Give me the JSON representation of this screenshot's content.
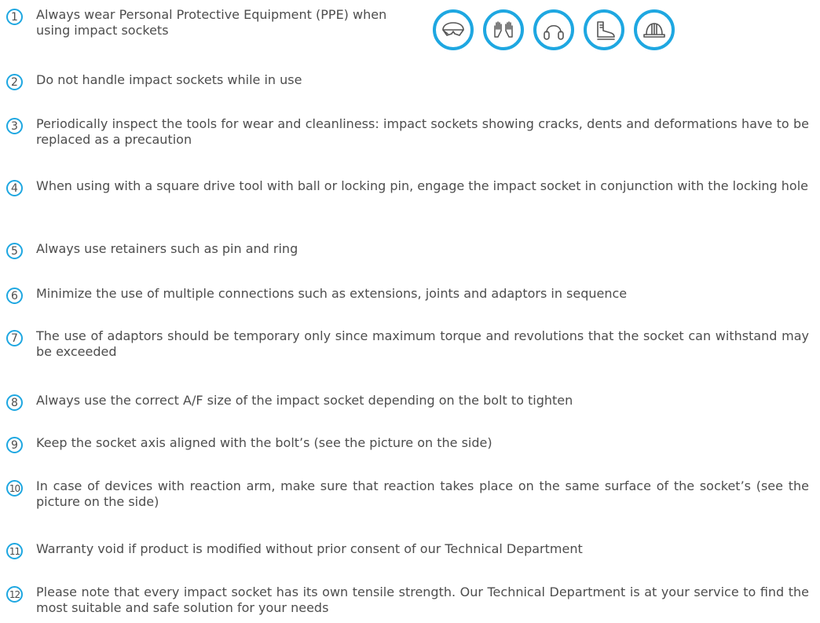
{
  "accent_color": "#1ea7e1",
  "text_color": "#4d4d4d",
  "ppe_icons": [
    "safety-glasses-icon",
    "gloves-icon",
    "ear-protection-icon",
    "safety-boot-icon",
    "hard-hat-icon"
  ],
  "items": [
    {
      "number": "1",
      "text": "Always wear Personal Protective Equipment (PPE) when using impact sockets"
    },
    {
      "number": "2",
      "text": "Do not handle impact sockets while in use"
    },
    {
      "number": "3",
      "text": "Periodically inspect the tools for wear and cleanliness: impact sockets showing cracks, dents and deformations have to be replaced as a precaution"
    },
    {
      "number": "4",
      "text": "When using with a square drive tool with ball or locking pin, engage the impact socket in conjunction with the locking hole"
    },
    {
      "number": "5",
      "text": "Always use retainers such as pin and ring"
    },
    {
      "number": "6",
      "text": "Minimize the use of multiple connections such as extensions, joints and adaptors in sequence"
    },
    {
      "number": "7",
      "text": "The use of adaptors should be temporary only since maximum torque and revolutions that the socket can withstand may be exceeded"
    },
    {
      "number": "8",
      "text": "Always use the correct A/F size of the impact socket depending on the bolt to tighten"
    },
    {
      "number": "9",
      "text": "Keep the socket axis aligned with the bolt’s (see the picture on the side)"
    },
    {
      "number": "10",
      "text": "In case of devices with reaction arm, make sure that reaction takes place on the same surface of the socket’s (see the picture on the side)"
    },
    {
      "number": "11",
      "text": "Warranty void if product is modified without prior consent of our Technical Department"
    },
    {
      "number": "12",
      "text": "Please note that every impact socket has its own tensile strength. Our Technical Department is at your service to find the most suitable and safe solution for your needs"
    }
  ]
}
